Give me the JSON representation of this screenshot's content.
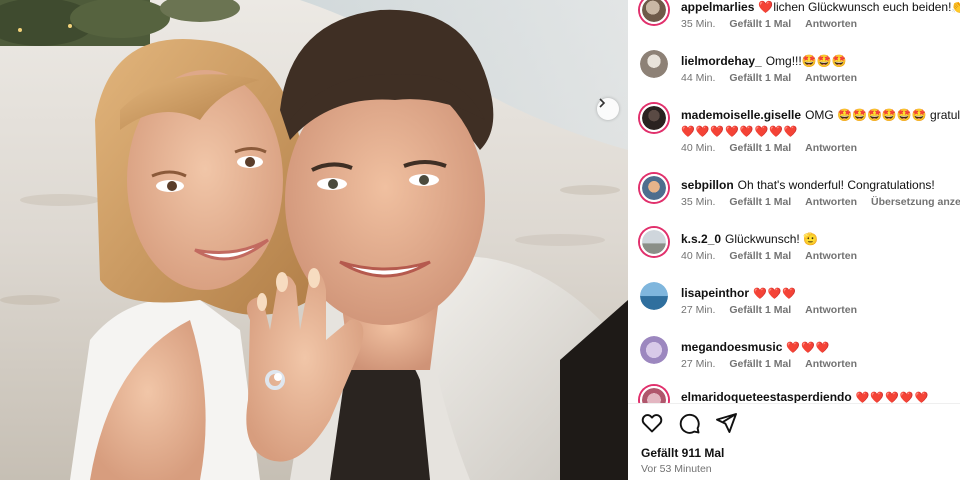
{
  "post": {
    "likes_label": "Gefällt 911 Mal",
    "time_label": "Vor 53 Minuten"
  },
  "icons": {
    "like": "heart-outline-icon",
    "comment": "speech-bubble-icon",
    "share": "paper-plane-icon",
    "carousel_next": "chevron-right-icon"
  },
  "colors": {
    "story_ring": "#e1306c",
    "heart": "#e0102b",
    "meta_text": "#737373"
  },
  "comments": [
    {
      "user": "appelmarlies",
      "text": "❤️lichen Glückwunsch euch beiden!👏🍾",
      "time": "35 Min.",
      "likes": "Gefällt 1 Mal",
      "reply": "Antworten"
    },
    {
      "user": "lielmordehay_",
      "text": "Omg!!!🤩🤩🤩",
      "time": "44 Min.",
      "likes": "Gefällt 1 Mal",
      "reply": "Antworten"
    },
    {
      "user": "mademoiselle.giselle",
      "text": "OMG 🤩🤩🤩🤩🤩🤩 gratulie",
      "text2": "❤️❤️❤️❤️❤️❤️❤️❤️",
      "time": "40 Min.",
      "likes": "Gefällt 1 Mal",
      "reply": "Antworten"
    },
    {
      "user": "sebpillon",
      "text": "Oh that's wonderful! Congratulations!",
      "time": "35 Min.",
      "likes": "Gefällt 1 Mal",
      "reply": "Antworten",
      "translate": "Übersetzung anzeigen"
    },
    {
      "user": "k.s.2_0",
      "text": "Glückwunsch! 🫡",
      "time": "40 Min.",
      "likes": "Gefällt 1 Mal",
      "reply": "Antworten"
    },
    {
      "user": "lisapeinthor",
      "text": "❤️❤️❤️",
      "time": "27 Min.",
      "likes": "Gefällt 1 Mal",
      "reply": "Antworten"
    },
    {
      "user": "megandoesmusic",
      "text": "❤️❤️❤️",
      "time": "27 Min.",
      "likes": "Gefällt 1 Mal",
      "reply": "Antworten"
    },
    {
      "user": "elmaridoqueteestasperdiendo",
      "text": "❤️❤️❤️❤️❤️"
    }
  ]
}
